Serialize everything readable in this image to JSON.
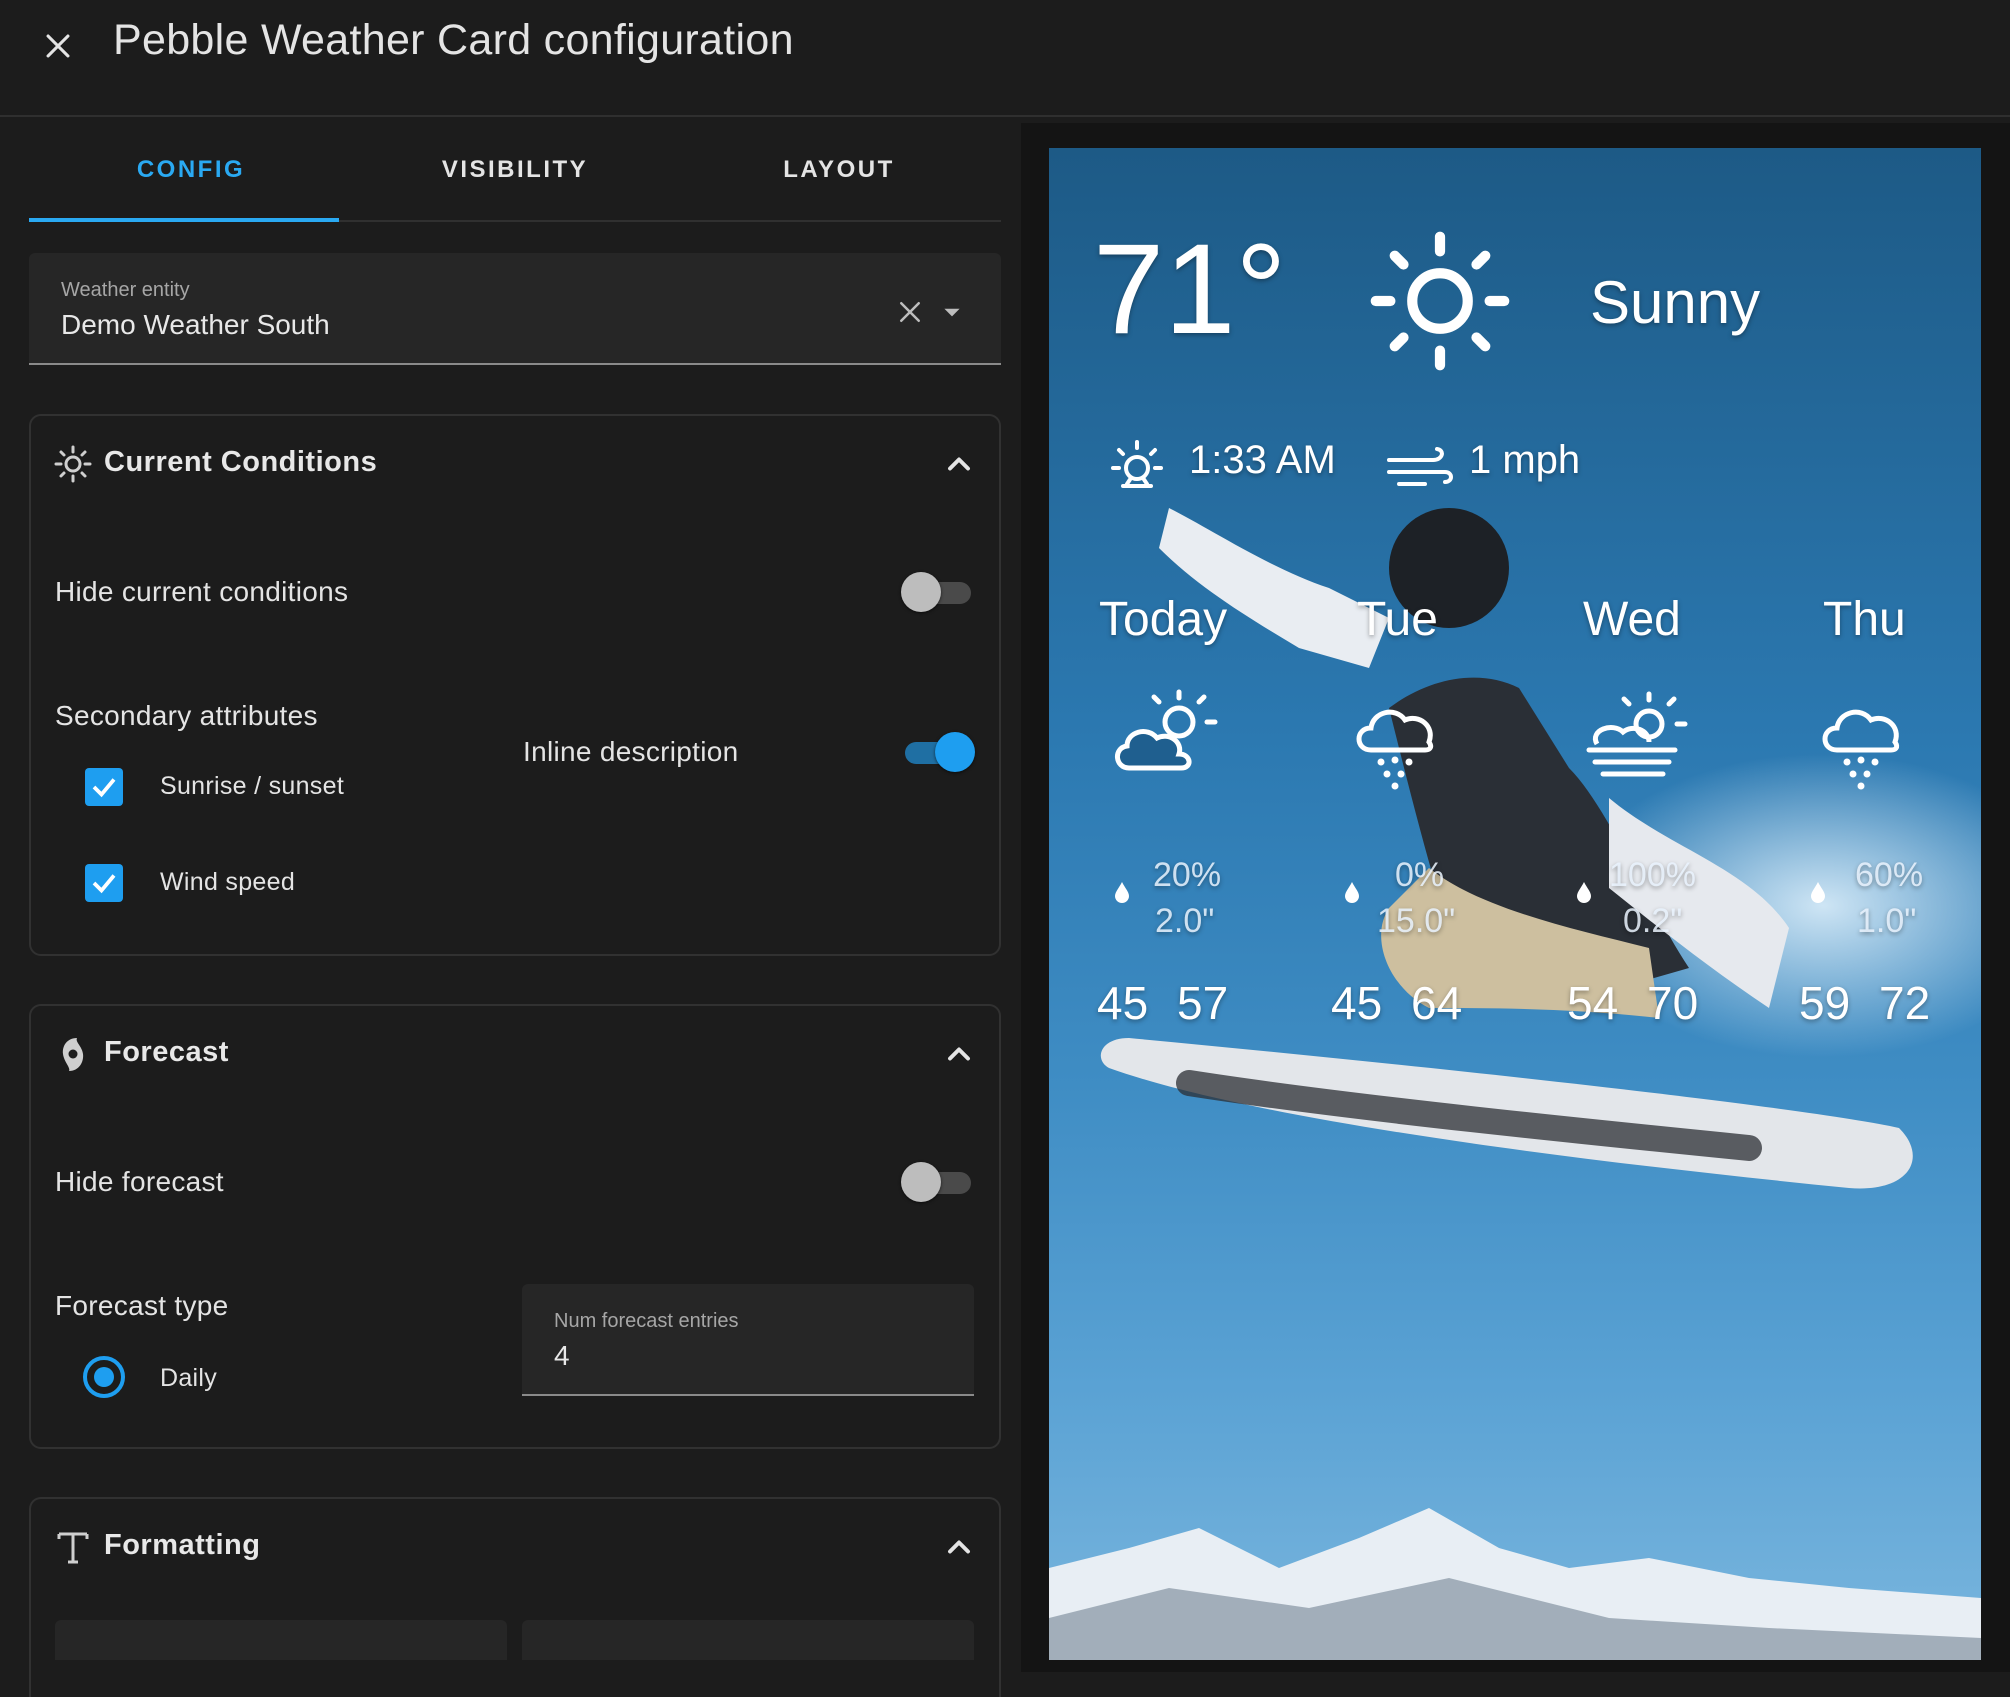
{
  "header": {
    "title": "Pebble Weather Card configuration",
    "close_icon": "close-icon"
  },
  "tabs": [
    {
      "label": "CONFIG",
      "active": true
    },
    {
      "label": "VISIBILITY"
    },
    {
      "label": "LAYOUT"
    }
  ],
  "entity": {
    "label": "Weather entity",
    "value": "Demo Weather South"
  },
  "current": {
    "title": "Current Conditions",
    "hide_label": "Hide current conditions",
    "hide_on": false,
    "secondary_label": "Secondary attributes",
    "sunrise_label": "Sunrise / sunset",
    "sunrise_checked": true,
    "wind_label": "Wind speed",
    "wind_checked": true,
    "inline_label": "Inline description",
    "inline_on": true
  },
  "forecast": {
    "title": "Forecast",
    "hide_label": "Hide forecast",
    "hide_on": false,
    "type_label": "Forecast type",
    "daily_label": "Daily",
    "daily_selected": true,
    "num_label": "Num forecast entries",
    "num_value": "4"
  },
  "formatting": {
    "title": "Formatting"
  },
  "preview": {
    "temp": "71°",
    "condition": "Sunny",
    "sunrise": "1:33 AM",
    "wind": "1 mph",
    "days": [
      {
        "name": "Today",
        "icon": "partly-cloudy-icon",
        "precip_pct": "20%",
        "precip_amt": "2.0\"",
        "low": "45",
        "high": "57"
      },
      {
        "name": "Tue",
        "icon": "rain-icon",
        "precip_pct": "0%",
        "precip_amt": "15.0\"",
        "low": "45",
        "high": "64"
      },
      {
        "name": "Wed",
        "icon": "fog-icon",
        "precip_pct": "100%",
        "precip_amt": "0.2\"",
        "low": "54",
        "high": "70"
      },
      {
        "name": "Thu",
        "icon": "rain-icon",
        "precip_pct": "60%",
        "precip_amt": "1.0\"",
        "low": "59",
        "high": "72"
      }
    ]
  },
  "colors": {
    "accent": "#2aa9f2",
    "switch_on": "#1e9ef0",
    "background": "#1c1c1c",
    "field": "#262626"
  }
}
